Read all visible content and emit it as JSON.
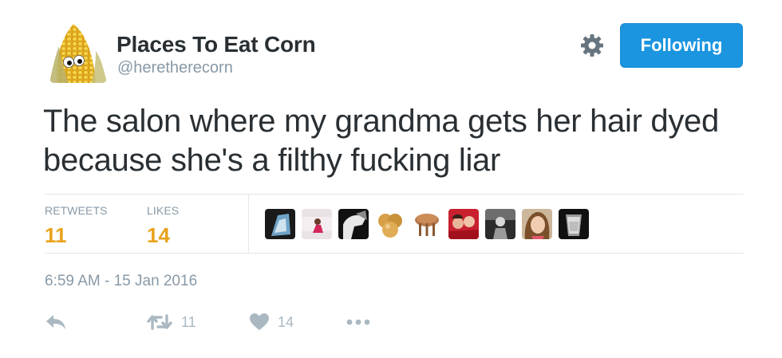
{
  "author": {
    "display_name": "Places To Eat Corn",
    "handle": "@heretherecorn",
    "avatar": "corn-with-googly-eyes"
  },
  "header": {
    "settings_icon": "gear-icon",
    "follow_button_label": "Following",
    "follow_button_color": "#1b95e0"
  },
  "tweet": {
    "text_lines": [
      "The salon where my grandma gets her hair dyed",
      "because she's a filthy fucking liar"
    ]
  },
  "stats": {
    "retweets_label": "RETWEETS",
    "retweets_count": "11",
    "likes_label": "LIKES",
    "likes_count": "14",
    "count_color": "#e8a31b"
  },
  "likers": [
    "liker-avatar-1",
    "liker-avatar-2",
    "liker-avatar-3",
    "liker-avatar-4",
    "liker-avatar-5",
    "liker-avatar-6",
    "liker-avatar-7",
    "liker-avatar-8",
    "liker-avatar-9"
  ],
  "timestamp": "6:59 AM - 15 Jan 2016",
  "actions": {
    "reply_icon": "reply-icon",
    "retweet_icon": "retweet-icon",
    "retweet_count": "11",
    "like_icon": "heart-icon",
    "like_count": "14",
    "more_icon": "more-dots-icon"
  }
}
